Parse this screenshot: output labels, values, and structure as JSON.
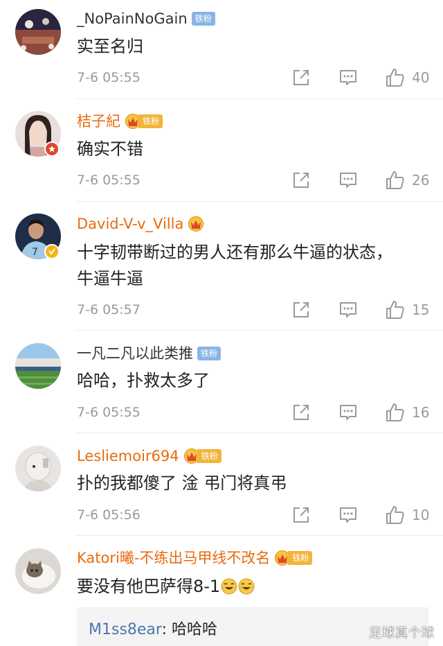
{
  "comments": [
    {
      "username": "_NoPainNoGain",
      "badge": "铁粉",
      "text": "实至名归",
      "time": "7-6 05:55",
      "likes": "40"
    },
    {
      "username": "桔子紀",
      "badge": "铁粉",
      "text": "确实不错",
      "time": "7-6 05:55",
      "likes": "26"
    },
    {
      "username": "David-V-v_Villa",
      "text_line1": "十字韧带断过的男人还有那么牛逼的状态，",
      "text_line2": "牛逼牛逼",
      "time": "7-6 05:57",
      "likes": "15"
    },
    {
      "username": "一凡二凡以此类推",
      "badge": "铁粉",
      "text": "哈哈，扑救太多了",
      "time": "7-6 05:55",
      "likes": "16"
    },
    {
      "username": "Lesliemoir694",
      "badge": "铁粉",
      "text": "扑的我都傻了 淦  弔门将真弔",
      "time": "7-6 05:56",
      "likes": "10"
    },
    {
      "username": "Katori曦-不练出马甲线不改名",
      "badge": "铁粉",
      "text": "要没有他巴萨得8-1",
      "reply": {
        "username": "M1ss8ear",
        "text": ": 哈哈哈"
      }
    }
  ],
  "watermark": "足球真个球",
  "colors": {
    "orange_name": "#e86b0f",
    "gray_text": "#9a9a9a",
    "blue_badge": "#8ab4e6",
    "gold_badge": "#f2b43a",
    "reply_link": "#4a78b0"
  }
}
